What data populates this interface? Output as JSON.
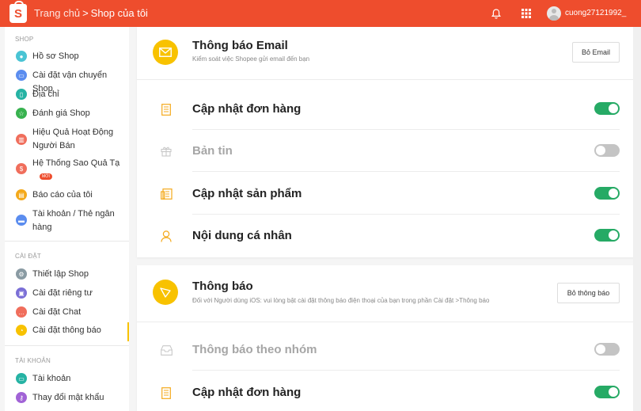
{
  "topbar": {
    "home_label": "Trang chủ",
    "separator": ">",
    "current_label": "Shop của tôi",
    "username": "cuong27121992_",
    "brand_color": "#ee4d2d",
    "logo_letter": "S"
  },
  "sidebar": {
    "sections": [
      {
        "title": "SHOP",
        "items": [
          {
            "label": "Hồ sơ Shop",
            "icon": "profile-icon",
            "color": "#4ac4d4"
          },
          {
            "label": "Cài đặt vận chuyển Shop",
            "icon": "shipping-icon",
            "color": "#5b8def"
          },
          {
            "label": "Địa chỉ",
            "icon": "address-icon",
            "color": "#26b3a4"
          },
          {
            "label": "Đánh giá Shop",
            "icon": "star-icon",
            "color": "#38b24f"
          },
          {
            "label": "Hiệu Quả Hoạt Động Người Bán",
            "icon": "chart-icon",
            "color": "#f06e5c"
          },
          {
            "label": "Hệ Thống Sao Quả Tạ",
            "icon": "dollar-icon",
            "color": "#f06e5c",
            "badge": "MỚI"
          },
          {
            "label": "Báo cáo của tôi",
            "icon": "report-icon",
            "color": "#f4a91b"
          },
          {
            "label": "Tài khoản / Thẻ ngân hàng",
            "icon": "bank-icon",
            "color": "#5b8def"
          }
        ]
      },
      {
        "title": "CÀI ĐẶT",
        "items": [
          {
            "label": "Thiết lập Shop",
            "icon": "gear-icon",
            "color": "#8a9ba3"
          },
          {
            "label": "Cài đặt riêng tư",
            "icon": "lock-icon",
            "color": "#7b6fd6"
          },
          {
            "label": "Cài đặt Chat",
            "icon": "chat-icon",
            "color": "#f06e5c"
          },
          {
            "label": "Cài đặt thông báo",
            "icon": "notification-icon",
            "color": "#f8c200",
            "active": true
          }
        ]
      },
      {
        "title": "TÀI KHOẢN",
        "items": [
          {
            "label": "Tài khoản",
            "icon": "account-icon",
            "color": "#26b3a4"
          },
          {
            "label": "Thay đổi mật khẩu",
            "icon": "key-icon",
            "color": "#a163d6"
          }
        ]
      }
    ]
  },
  "email_panel": {
    "title": "Thông báo Email",
    "description": "Kiểm soát việc Shopee gửi email đến bạn",
    "button": "Bỏ Email",
    "rows": [
      {
        "label": "Cập nhật đơn hàng",
        "icon": "document-icon",
        "enabled": true
      },
      {
        "label": "Bản tin",
        "icon": "gift-icon",
        "enabled": false
      },
      {
        "label": "Cập nhật sản phẩm",
        "icon": "product-icon",
        "enabled": true
      },
      {
        "label": "Nội dung cá nhân",
        "icon": "person-icon",
        "enabled": true
      }
    ]
  },
  "push_panel": {
    "title": "Thông báo",
    "description": "Đối với Người dùng iOS: vui lòng bật cài đặt thông báo điện thoại của bạn trong phần Cài đặt >Thông báo",
    "button": "Bỏ thông báo",
    "rows": [
      {
        "label": "Thông báo theo nhóm",
        "icon": "inbox-icon",
        "enabled": false
      },
      {
        "label": "Cập nhật đơn hàng",
        "icon": "document-icon",
        "enabled": true
      }
    ]
  },
  "colors": {
    "accent": "#f8c200",
    "toggle_on": "#26aa65",
    "toggle_off": "#c4c4c4"
  }
}
